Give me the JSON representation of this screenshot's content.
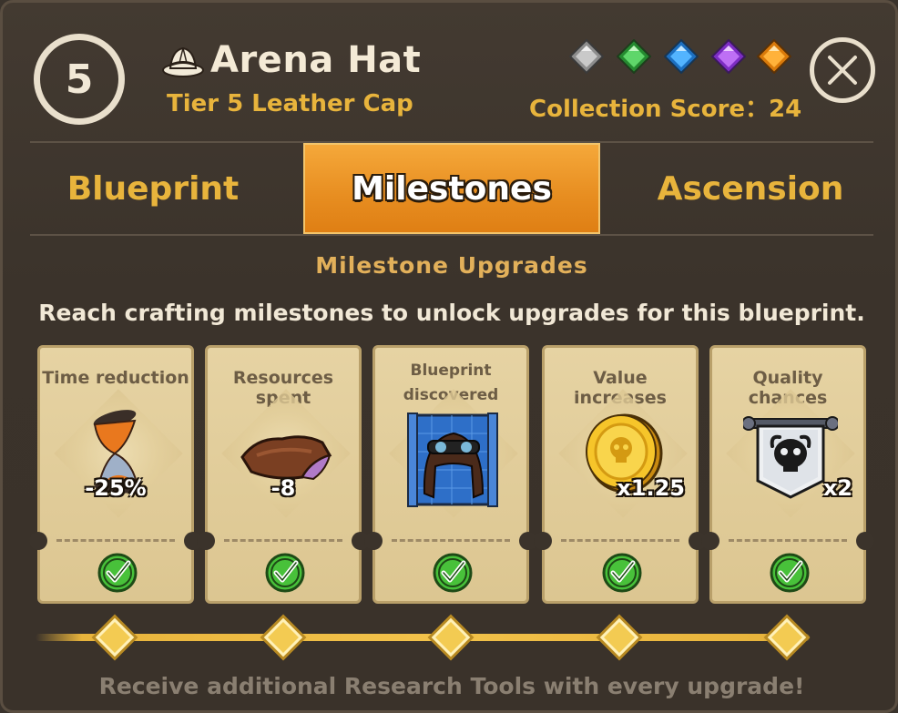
{
  "header": {
    "tier_number": "5",
    "title": "Arena Hat",
    "subtitle": "Tier 5 Leather Cap",
    "collection_score": "Collection Score：24",
    "gems": [
      {
        "name": "silver-gem-icon",
        "color": "#9a9a9a"
      },
      {
        "name": "green-gem-icon",
        "color": "#3fb24a"
      },
      {
        "name": "blue-gem-icon",
        "color": "#2f8fe0"
      },
      {
        "name": "purple-gem-icon",
        "color": "#9a45e0"
      },
      {
        "name": "orange-gem-icon",
        "color": "#f09a1a"
      }
    ]
  },
  "tabs": [
    {
      "label": "Blueprint",
      "active": false
    },
    {
      "label": "Milestones",
      "active": true
    },
    {
      "label": "Ascension",
      "active": false
    }
  ],
  "section": {
    "title": "Milestone Upgrades",
    "description": "Reach crafting milestones to unlock upgrades for this blueprint."
  },
  "milestones": [
    {
      "label": "Time reduction",
      "value": "-25%",
      "icon": "hourglass-icon",
      "completed": true
    },
    {
      "label": "Resources spent",
      "value": "-8",
      "icon": "leather-icon",
      "completed": true
    },
    {
      "label": "Blueprint discovered",
      "label_line1": "Blueprint",
      "label_line2": "discovered",
      "value": "",
      "icon": "leather-cap-blueprint-icon",
      "completed": true
    },
    {
      "label": "Value increases",
      "value": "x1.25",
      "icon": "gold-coin-icon",
      "completed": true
    },
    {
      "label": "Quality chances",
      "value": "x2",
      "icon": "skull-banner-icon",
      "completed": true
    }
  ],
  "footer": "Receive additional Research Tools with every upgrade!",
  "colors": {
    "accent": "#e8b43c",
    "active_tab": "#e78d20",
    "card_bg": "#e6d3a3",
    "check_green": "#3fb23a"
  }
}
